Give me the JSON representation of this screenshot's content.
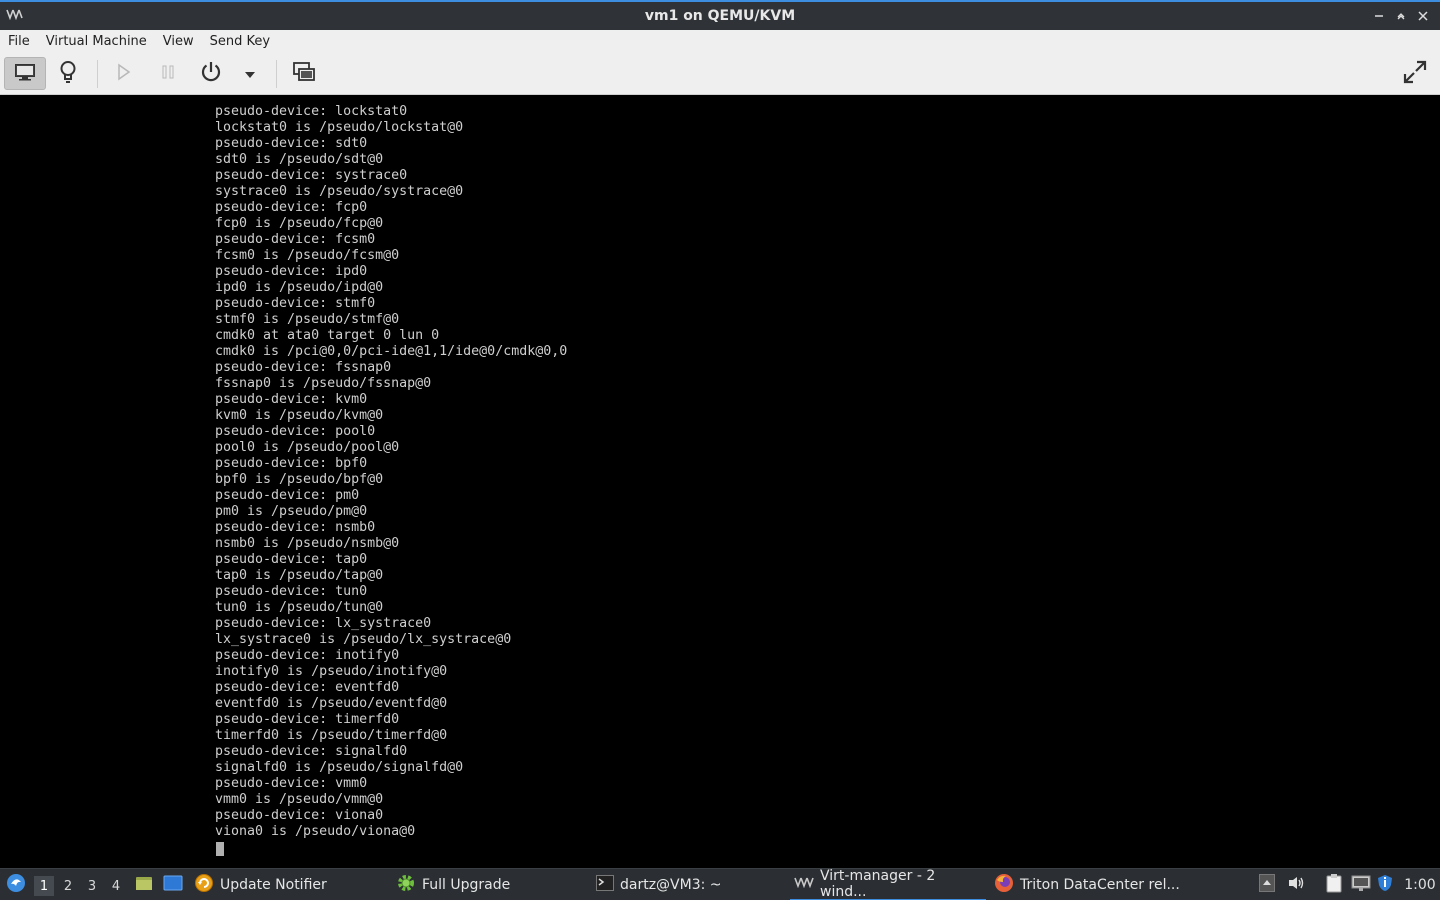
{
  "window": {
    "title": "vm1 on QEMU/KVM",
    "controls": [
      "minimize-icon",
      "restore-icon",
      "close-icon"
    ]
  },
  "menu": [
    "File",
    "Virtual Machine",
    "View",
    "Send Key"
  ],
  "toolbar": {
    "buttons": [
      "console-view-icon",
      "details-view-icon",
      "run-icon",
      "pause-icon",
      "power-icon",
      "shutdown-menu-icon",
      "snapshots-icon",
      "fullscreen-icon"
    ]
  },
  "console": {
    "lines": [
      "pseudo-device: lockstat0",
      "lockstat0 is /pseudo/lockstat@0",
      "pseudo-device: sdt0",
      "sdt0 is /pseudo/sdt@0",
      "pseudo-device: systrace0",
      "systrace0 is /pseudo/systrace@0",
      "pseudo-device: fcp0",
      "fcp0 is /pseudo/fcp@0",
      "pseudo-device: fcsm0",
      "fcsm0 is /pseudo/fcsm@0",
      "pseudo-device: ipd0",
      "ipd0 is /pseudo/ipd@0",
      "pseudo-device: stmf0",
      "stmf0 is /pseudo/stmf@0",
      "cmdk0 at ata0 target 0 lun 0",
      "cmdk0 is /pci@0,0/pci-ide@1,1/ide@0/cmdk@0,0",
      "pseudo-device: fssnap0",
      "fssnap0 is /pseudo/fssnap@0",
      "pseudo-device: kvm0",
      "kvm0 is /pseudo/kvm@0",
      "pseudo-device: pool0",
      "pool0 is /pseudo/pool@0",
      "pseudo-device: bpf0",
      "bpf0 is /pseudo/bpf@0",
      "pseudo-device: pm0",
      "pm0 is /pseudo/pm@0",
      "pseudo-device: nsmb0",
      "nsmb0 is /pseudo/nsmb@0",
      "pseudo-device: tap0",
      "tap0 is /pseudo/tap@0",
      "pseudo-device: tun0",
      "tun0 is /pseudo/tun@0",
      "pseudo-device: lx_systrace0",
      "lx_systrace0 is /pseudo/lx_systrace@0",
      "pseudo-device: inotify0",
      "inotify0 is /pseudo/inotify@0",
      "pseudo-device: eventfd0",
      "eventfd0 is /pseudo/eventfd@0",
      "pseudo-device: timerfd0",
      "timerfd0 is /pseudo/timerfd@0",
      "pseudo-device: signalfd0",
      "signalfd0 is /pseudo/signalfd@0",
      "pseudo-device: vmm0",
      "vmm0 is /pseudo/vmm@0",
      "pseudo-device: viona0",
      "viona0 is /pseudo/viona@0"
    ]
  },
  "taskbar": {
    "workspaces": [
      "1",
      "2",
      "3",
      "4"
    ],
    "active_workspace": "1",
    "tasks": [
      {
        "label": "Update Notifier",
        "icon": "update-notifier-icon"
      },
      {
        "label": "Full Upgrade",
        "icon": "gear-icon"
      },
      {
        "label": "dartz@VM3: ~",
        "icon": "terminal-icon"
      },
      {
        "label": "Virt-manager - 2 wind...",
        "icon": "virt-manager-icon"
      },
      {
        "label": "Triton DataCenter rel...",
        "icon": "firefox-icon"
      }
    ],
    "clock": "1:00"
  },
  "colors": {
    "accent": "#3d8ee0",
    "titlebar": "#2f3337",
    "taskbar": "#2b2f33",
    "console_text": "#cfcfcf"
  }
}
